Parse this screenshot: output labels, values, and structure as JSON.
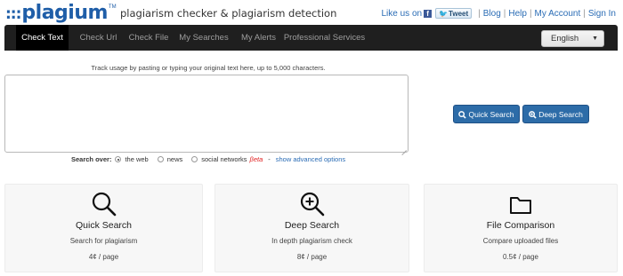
{
  "header": {
    "logo_dots": ":::",
    "logo_text": "plagium",
    "logo_tm": "TM",
    "tagline": "plagiarism checker & plagiarism detection",
    "like_us": "Like us on",
    "fb_glyph": "f",
    "tweet_label": "Tweet",
    "links": [
      "Blog",
      "Help",
      "My Account",
      "Sign In"
    ],
    "separator": "|"
  },
  "nav": {
    "items": [
      "Check Text",
      "Check Url",
      "Check File",
      "My Searches",
      "My Alerts",
      "Professional Services"
    ],
    "active": "Check Text",
    "language": "English",
    "language_caret": "▼"
  },
  "main": {
    "hint": "Track usage by pasting or typing your original text here, up to 5,000 characters.",
    "text_value": "",
    "quick_search": "Quick Search",
    "deep_search": "Deep Search",
    "search_over_label": "Search over:",
    "options": [
      {
        "label": "the web",
        "checked": true
      },
      {
        "label": "news",
        "checked": false
      },
      {
        "label": "social networks",
        "checked": false
      }
    ],
    "beta": "βeta",
    "dash": "-",
    "advanced": "show advanced options"
  },
  "cards": [
    {
      "icon": "magnifier-icon",
      "title": "Quick Search",
      "desc": "Search for plagiarism",
      "price": "4¢ / page"
    },
    {
      "icon": "magnifier-plus-icon",
      "title": "Deep Search",
      "desc": "In depth plagiarism check",
      "price": "8¢ / page"
    },
    {
      "icon": "folder-icon",
      "title": "File Comparison",
      "desc": "Compare uploaded files",
      "price": "0.5¢ / page"
    }
  ],
  "colors": {
    "brand": "#1f5ea8",
    "nav_bg": "#1f1f1f",
    "button": "#2d6ca8",
    "link": "#2a6cb5",
    "beta": "#e02020"
  }
}
